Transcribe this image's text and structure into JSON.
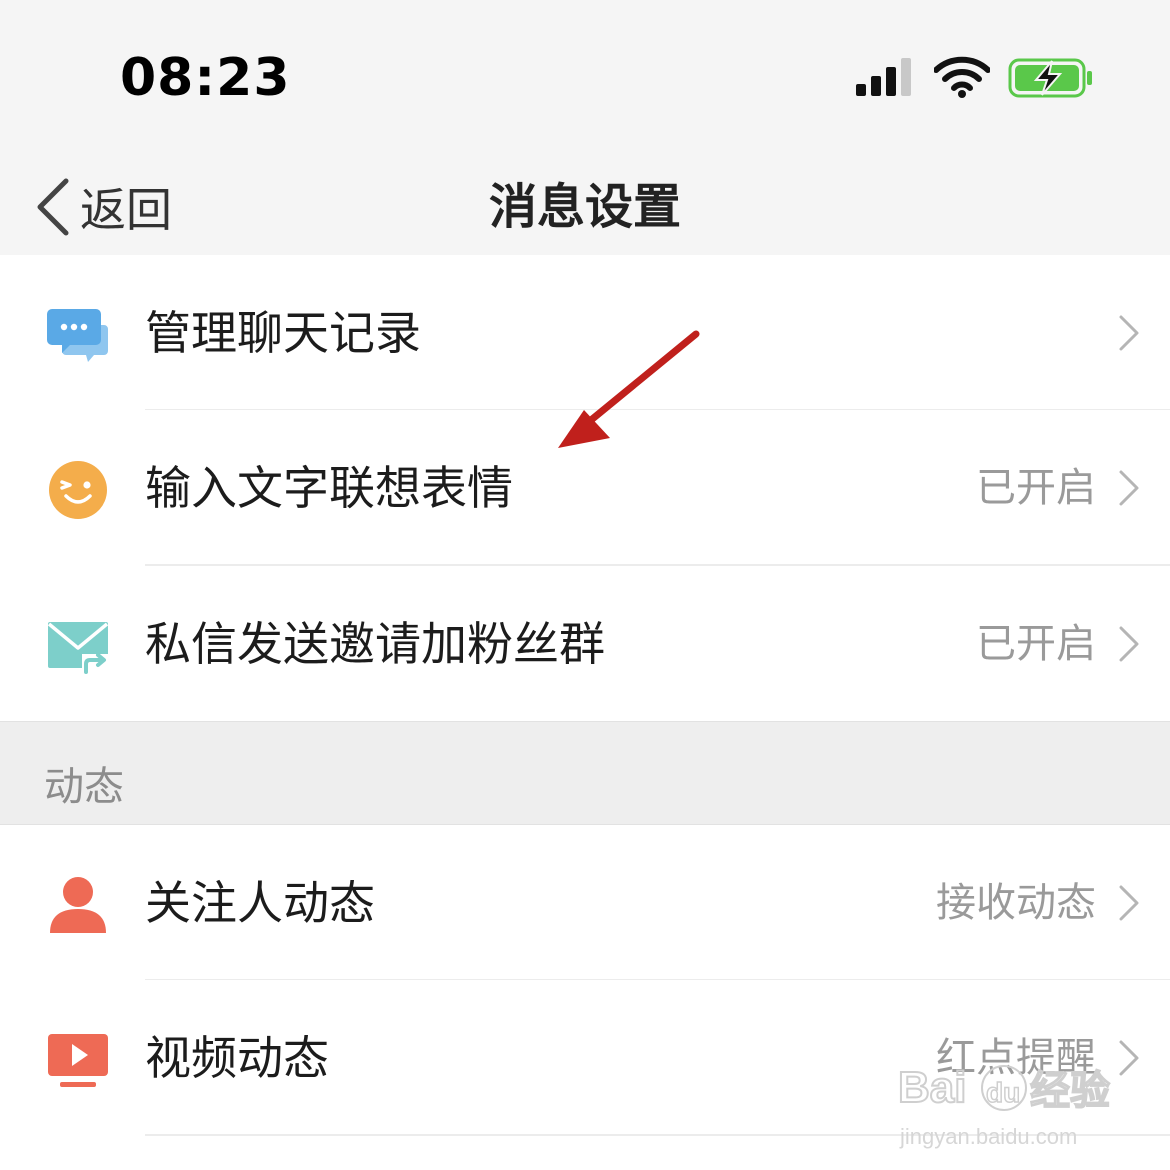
{
  "status_bar": {
    "time": "08:23",
    "icons": [
      "cellular-signal-icon",
      "wifi-icon",
      "battery-charging-icon"
    ],
    "battery_color": "#5ac84a"
  },
  "nav": {
    "back_label": "返回",
    "title": "消息设置"
  },
  "rows": [
    {
      "label": "管理聊天记录",
      "value": "",
      "icon": "chat-bubbles-icon",
      "icon_color": "#5aa9e6"
    },
    {
      "label": "输入文字联想表情",
      "value": "已开启",
      "icon": "smiley-face-icon",
      "icon_color": "#f4ad4b"
    },
    {
      "label": "私信发送邀请加粉丝群",
      "value": "已开启",
      "icon": "envelope-share-icon",
      "icon_color": "#7dcfca"
    }
  ],
  "section": {
    "title": "动态"
  },
  "section_rows": [
    {
      "label": "关注人动态",
      "value": "接收动态",
      "icon": "person-icon",
      "icon_color": "#ee6a55"
    },
    {
      "label": "视频动态",
      "value": "红点提醒",
      "icon": "video-play-icon",
      "icon_color": "#ee6a55"
    }
  ],
  "annotation": {
    "arrow_color": "#c0201c"
  },
  "watermark": {
    "text_top": "Bai",
    "text_mid": "du",
    "text_cn": "经验",
    "text_url": "jingyan.baidu.com"
  }
}
